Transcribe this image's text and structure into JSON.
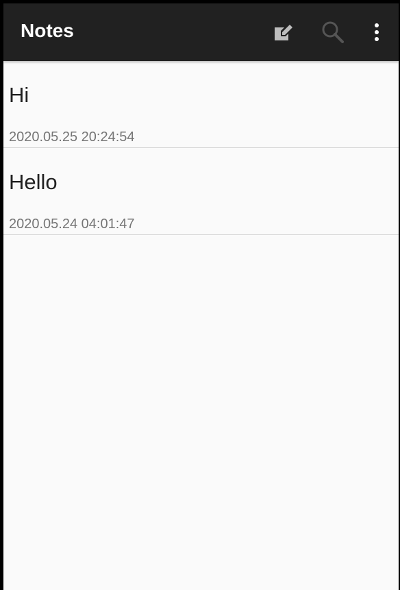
{
  "appbar": {
    "title": "Notes",
    "background": "#212121",
    "actions": [
      {
        "name": "compose",
        "icon": "edit-note-icon"
      },
      {
        "name": "search",
        "icon": "search-icon"
      },
      {
        "name": "more",
        "icon": "overflow-menu-icon"
      }
    ]
  },
  "notes": [
    {
      "title": "Hi",
      "timestamp": "2020.05.25 20:24:54"
    },
    {
      "title": "Hello",
      "timestamp": "2020.05.24 04:01:47"
    }
  ]
}
